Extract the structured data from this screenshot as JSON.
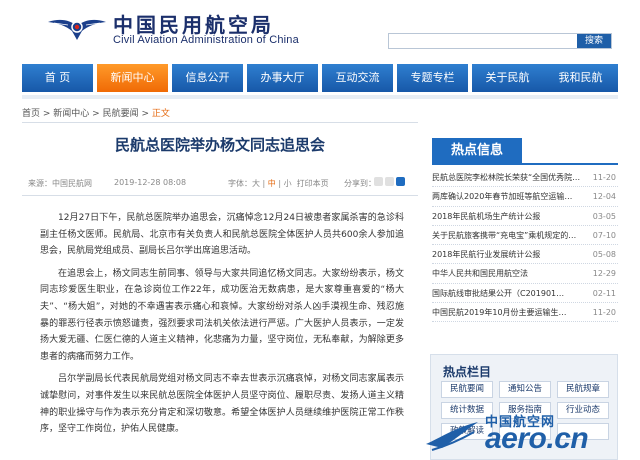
{
  "header": {
    "title_cn": "中国民用航空局",
    "title_en": "Civil Aviation Administration of China",
    "search_placeholder": "",
    "search_button": "搜索",
    "logo_colors": {
      "wing": "#1b3f8b",
      "accent": "#d9261c"
    }
  },
  "nav": {
    "items": [
      {
        "label": "首 页"
      },
      {
        "label": "新闻中心"
      },
      {
        "label": "信息公开"
      },
      {
        "label": "办事大厅"
      },
      {
        "label": "互动交流"
      },
      {
        "label": "专题专栏"
      },
      {
        "label": "关于民航"
      },
      {
        "label": "我和民航"
      }
    ],
    "active_index": 1,
    "colors": {
      "default": "#1f6cc0",
      "active": "#f07810"
    }
  },
  "breadcrumb": {
    "home": "首页",
    "sep1": " > ",
    "news": "新闻中心",
    "sep2": " > ",
    "section": "民航要闻",
    "sep3": " > ",
    "current": "正文"
  },
  "article": {
    "title": "民航总医院举办杨文同志追思会",
    "source": "来源：中国民航网",
    "date": "2019-12-28 08:08",
    "font_label": "字体：",
    "font_large": "大",
    "font_sep1": " | ",
    "font_medium": "中",
    "font_sep2": " | ",
    "font_small": "小",
    "print": "打印本页",
    "share": "分享到：",
    "paragraphs": [
      "12月27日下午，民航总医院举办追思会，沉痛悼念12月24日被患者家属杀害的急诊科副主任杨文医师。民航局、北京市有关负责人和民航总医院全体医护人员共600余人参加追思会，民航局党组成员、副局长吕尔学出席追思活动。",
      "在追思会上，杨文同志生前同事、领导与大家共同追忆杨文同志。大家纷纷表示，杨文同志珍爱医生职业，在急诊岗位工作22年，成功医治无数病患，是大家尊重喜爱的“杨大夫”、“杨大姐”，对她的不幸遇害表示痛心和哀悼。大家纷纷对杀人凶手漠视生命、残忍施暴的罪恶行径表示愤怒谴责，强烈要求司法机关依法进行严惩。广大医护人员表示，一定发扬大爱无疆、仁医仁德的人道主义精神，化悲痛为力量，坚守岗位，无私奉献，为解除更多患者的病痛而努力工作。",
      "吕尔学副局长代表民航局党组对杨文同志不幸去世表示沉痛哀悼，对杨文同志家属表示诚挚慰问，对事件发生以来民航总医院全体医护人员坚守岗位、履职尽责、发扬人道主义精神的职业操守与作为表示充分肯定和深切敬意。希望全体医护人员继续维护医院正常工作秩序，坚守工作岗位，护佑人民健康。"
    ]
  },
  "sidebar": {
    "hot_title": "热点信息",
    "hot_news": [
      {
        "title": "民航总医院李松林院长荣获“全国优秀院…",
        "date": "11-20"
      },
      {
        "title": "两库确认2020年春节加班等航空运输…",
        "date": "12-04"
      },
      {
        "title": "2018年民航机场生产统计公报",
        "date": "03-05"
      },
      {
        "title": "关于民航旅客携带“充电宝”乘机规定的…",
        "date": "07-10"
      },
      {
        "title": "2018年民航行业发展统计公报",
        "date": "05-08"
      },
      {
        "title": "中华人民共和国民用航空法",
        "date": "12-29"
      },
      {
        "title": "国际航线审批结果公开（C201901…",
        "date": "02-11"
      },
      {
        "title": "中国民航2019年10月份主要运输生…",
        "date": "11-20"
      }
    ],
    "column_title": "热点栏目",
    "column_buttons": [
      "民航要闻",
      "通知公告",
      "民航规章",
      "统计数据",
      "服务指南",
      "行业动态",
      "政策解读",
      "",
      ""
    ]
  },
  "watermark": {
    "cn": "中国航空网",
    "url": "aero.cn",
    "color": "#1f5fa8"
  }
}
